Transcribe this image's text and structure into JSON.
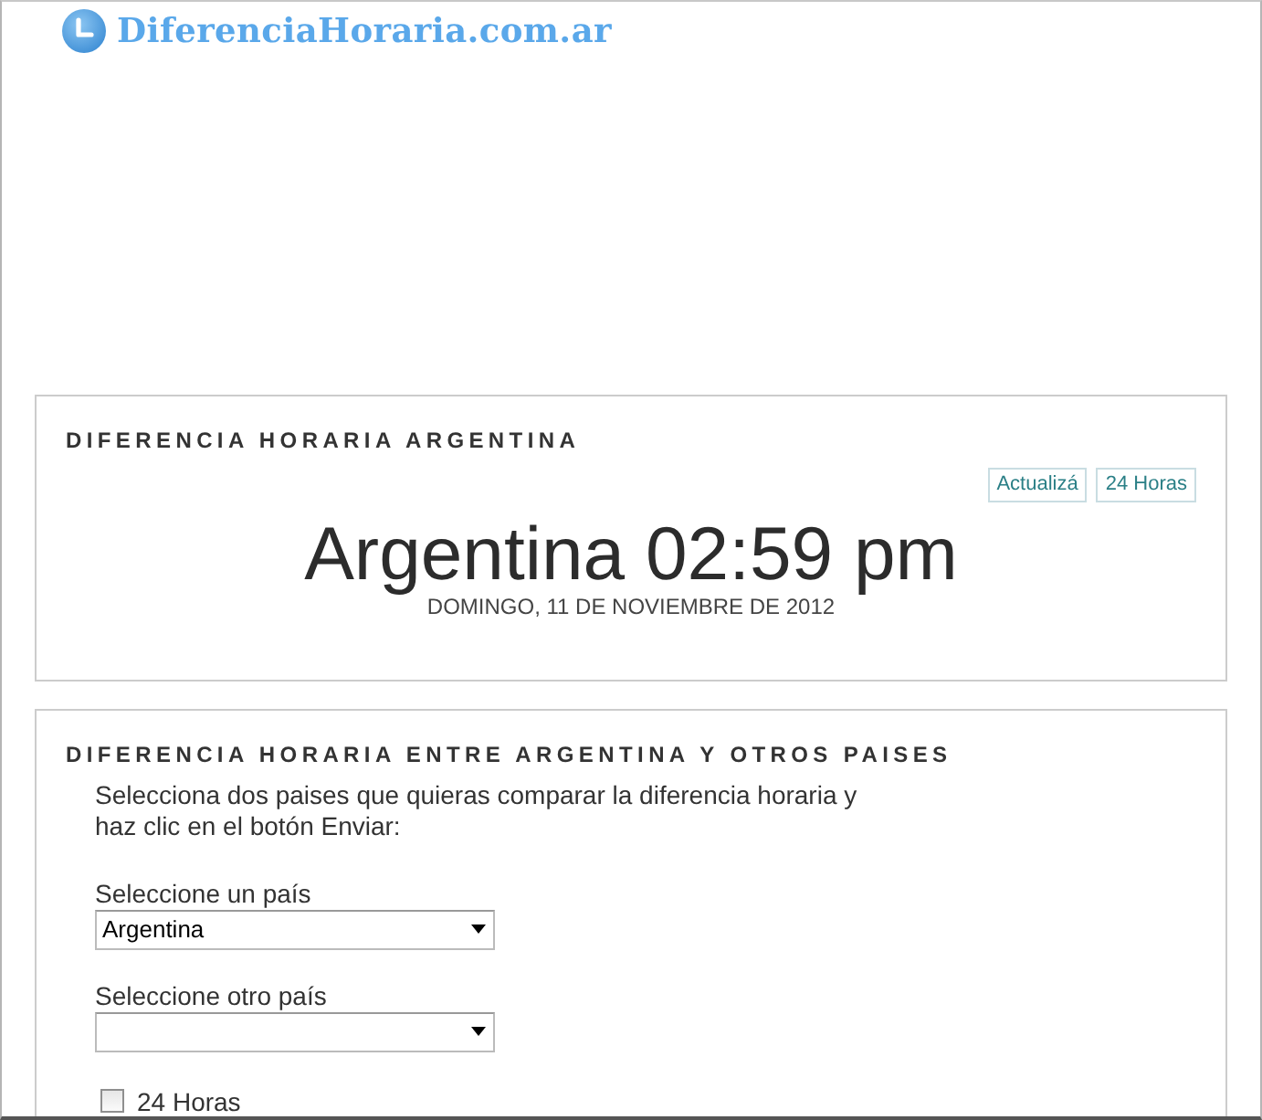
{
  "logo": {
    "text": "DiferenciaHoraria.com.ar"
  },
  "clock_panel": {
    "title": "DIFERENCIA HORARIA ARGENTINA",
    "buttons": [
      "Actualizá",
      "24 Horas"
    ],
    "time": "Argentina 02:59 pm",
    "date": "DOMINGO, 11 DE NOVIEMBRE DE 2012"
  },
  "compare_panel": {
    "title": "DIFERENCIA HORARIA ENTRE ARGENTINA Y OTROS PAISES",
    "instructions": "Selecciona dos paises que quieras comparar la diferencia horaria y haz clic en el botón Enviar:",
    "fields": [
      {
        "label": "Seleccione un país",
        "value": "Argentina"
      },
      {
        "label": "Seleccione otro país"
      }
    ],
    "checkbox": {
      "label": "24 Horas",
      "checked": false
    }
  }
}
